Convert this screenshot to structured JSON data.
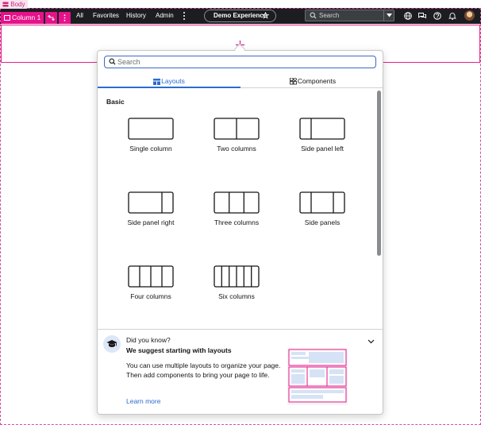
{
  "nav": {
    "links": [
      "All",
      "Favorites",
      "History",
      "Admin"
    ],
    "experience_label": "Demo Experience",
    "search_placeholder": "Search"
  },
  "canvas": {
    "body_label": "Body",
    "column_label": "Column 1"
  },
  "popover": {
    "search_placeholder": "Search",
    "tabs": [
      {
        "label": "Layouts",
        "icon": "layouts-icon",
        "active": true
      },
      {
        "label": "Components",
        "icon": "components-icon",
        "active": false
      }
    ],
    "section_title": "Basic",
    "layouts": [
      {
        "label": "Single column",
        "icon": "single-column-layout-icon"
      },
      {
        "label": "Two columns",
        "icon": "two-columns-layout-icon"
      },
      {
        "label": "Side panel left",
        "icon": "side-panel-left-layout-icon"
      },
      {
        "label": "Side panel right",
        "icon": "side-panel-right-layout-icon"
      },
      {
        "label": "Three columns",
        "icon": "three-columns-layout-icon"
      },
      {
        "label": "Side panels",
        "icon": "side-panels-layout-icon"
      },
      {
        "label": "Four columns",
        "icon": "four-columns-layout-icon"
      },
      {
        "label": "Six columns",
        "icon": "six-columns-layout-icon"
      }
    ],
    "tip": {
      "question": "Did you know?",
      "heading": "We suggest starting with layouts",
      "body": "You can use multiple layouts to organize your page. Then add components to bring your page to life.",
      "link": "Learn more"
    }
  },
  "colors": {
    "nav_bg": "#1b1d21",
    "accent_pink": "#e5128a",
    "link_blue": "#2c6ccf"
  }
}
